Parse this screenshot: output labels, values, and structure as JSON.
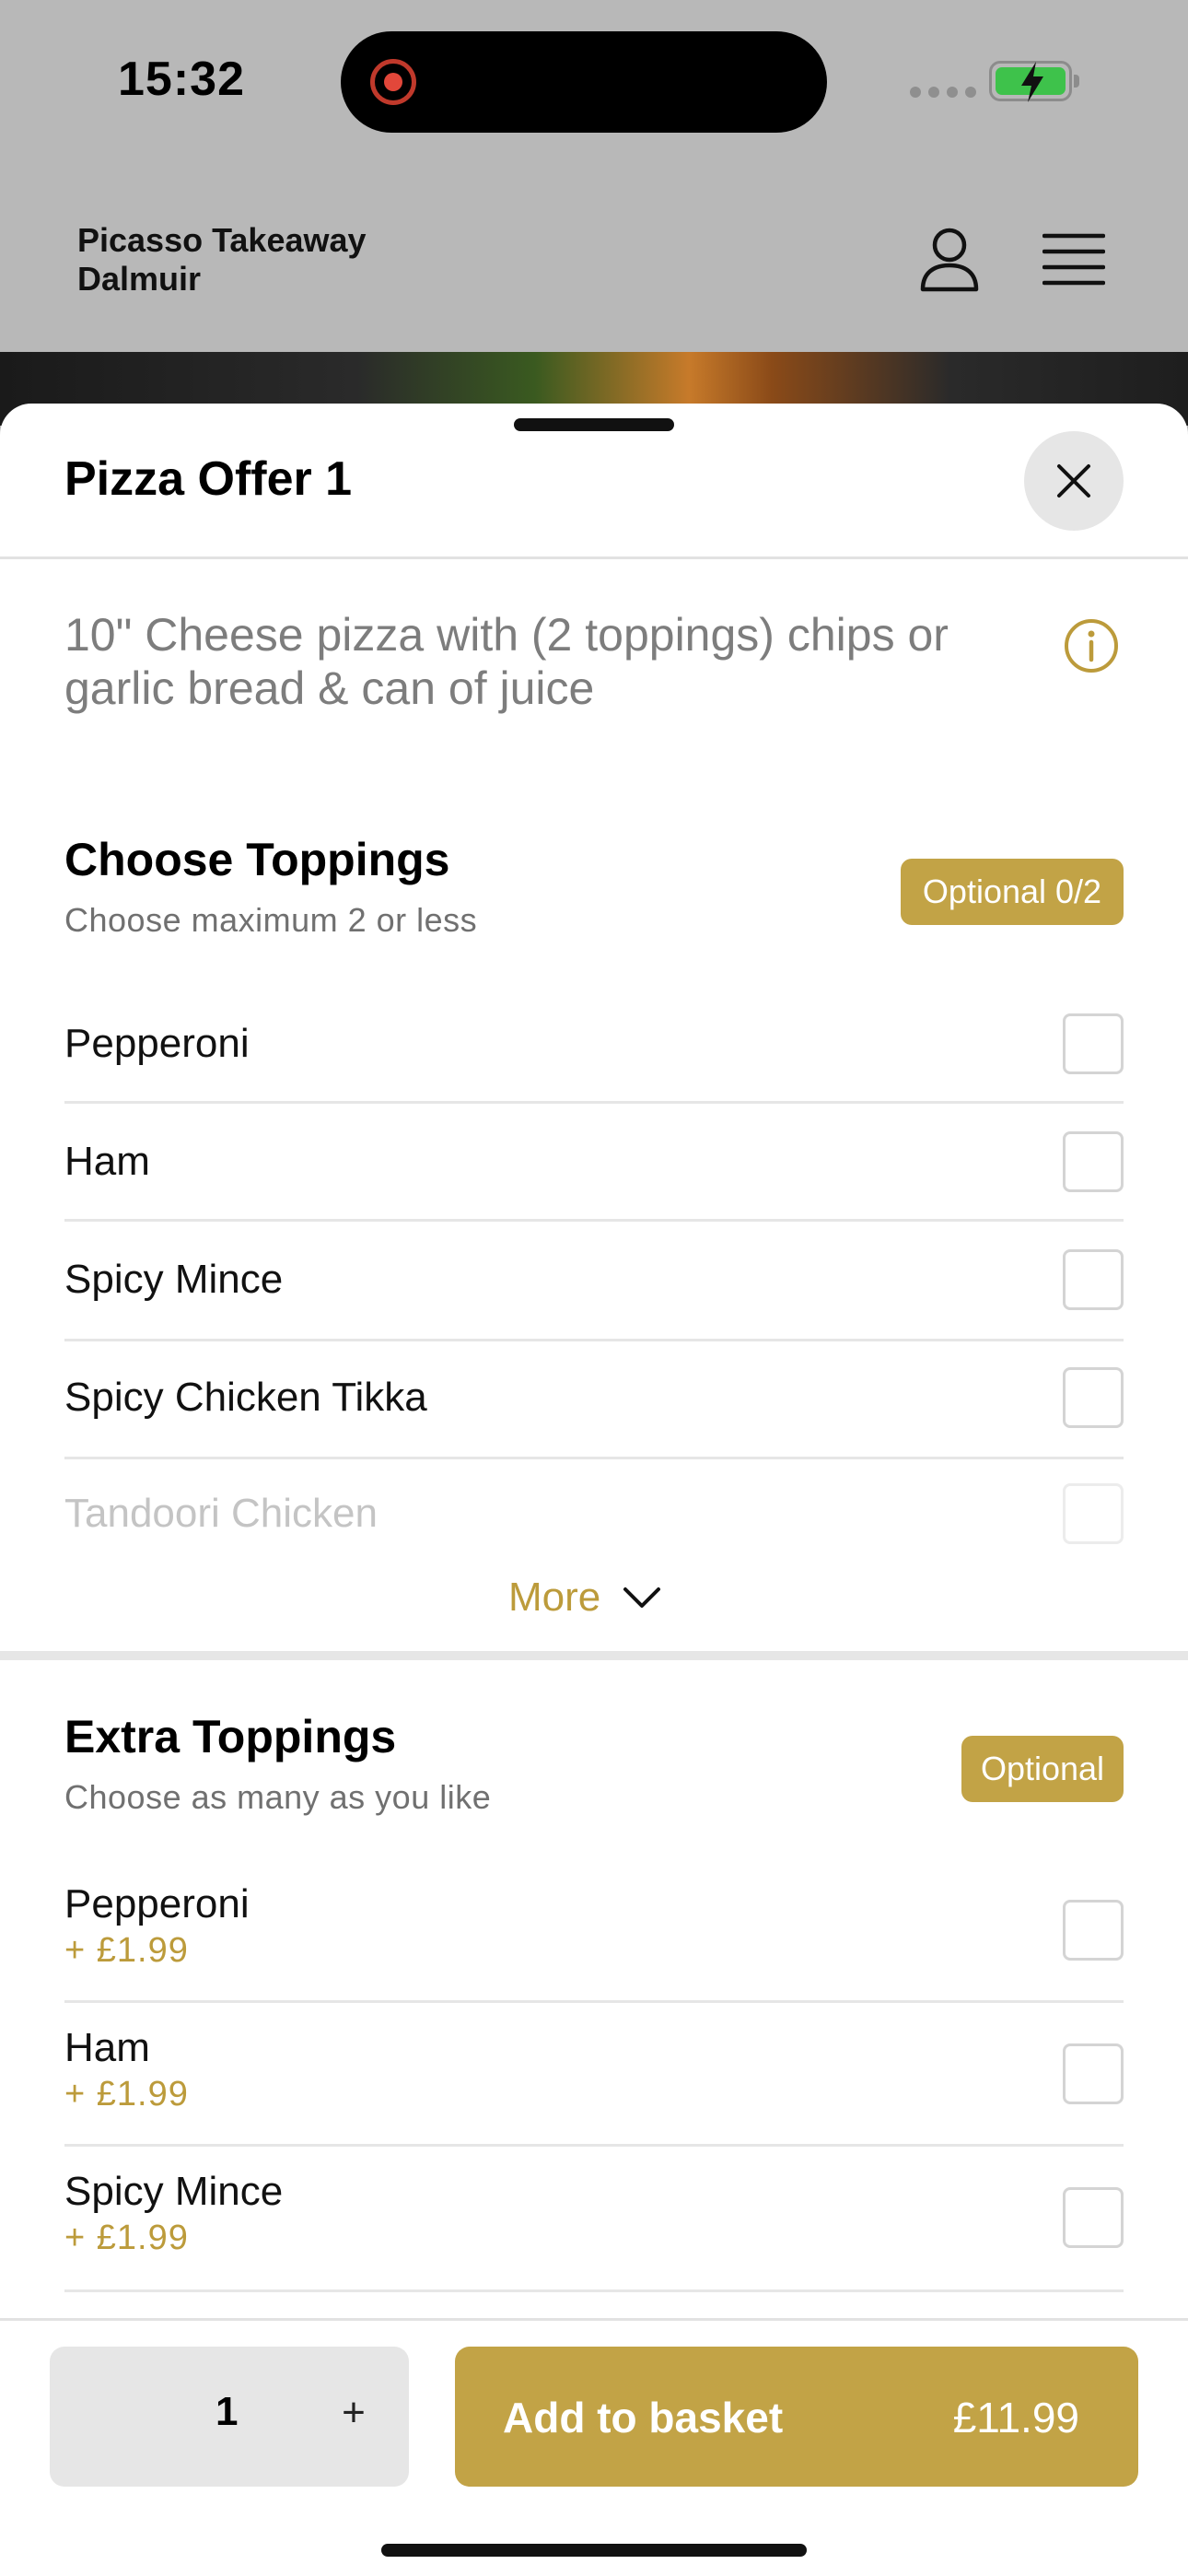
{
  "status_bar": {
    "time": "15:32",
    "recording_color": "#e2473a",
    "battery_color": "#3ec24b"
  },
  "header": {
    "brand_line1": "Picasso Takeaway",
    "brand_line2": "Dalmuir",
    "icons": [
      "user-icon",
      "menu-icon"
    ]
  },
  "sheet": {
    "title": "Pizza Offer 1",
    "description": "10\" Cheese pizza with (2 toppings) chips or garlic bread & can of juice",
    "accent_color": "#c2a346"
  },
  "choose_toppings": {
    "title": "Choose Toppings",
    "subtitle": "Choose maximum 2 or less",
    "badge": "Optional 0/2",
    "items": [
      {
        "label": "Pepperoni",
        "checked": false
      },
      {
        "label": "Ham",
        "checked": false
      },
      {
        "label": "Spicy Mince",
        "checked": false
      },
      {
        "label": "Spicy Chicken Tikka",
        "checked": false
      },
      {
        "label": "Tandoori Chicken",
        "checked": false
      }
    ],
    "more_label": "More"
  },
  "extra_toppings": {
    "title": "Extra Toppings",
    "subtitle": "Choose as many as you like",
    "badge": "Optional",
    "items": [
      {
        "label": "Pepperoni",
        "price": "+ £1.99",
        "checked": false
      },
      {
        "label": "Ham",
        "price": "+ £1.99",
        "checked": false
      },
      {
        "label": "Spicy Mince",
        "price": "+ £1.99",
        "checked": false
      }
    ]
  },
  "footer": {
    "quantity": "1",
    "plus_label": "+",
    "add_label": "Add to basket",
    "total": "£11.99"
  }
}
